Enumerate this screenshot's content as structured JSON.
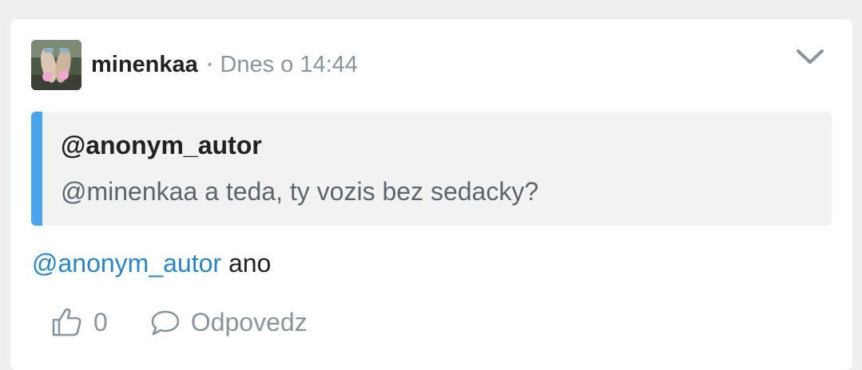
{
  "post": {
    "username": "minenkaa",
    "separator": "•",
    "timestamp": "Dnes o 14:44",
    "menu_icon": "chevron-down-icon",
    "quote": {
      "author": "@anonym_autor",
      "text": "@minenkaa a teda, ty vozis bez sedacky?"
    },
    "body": {
      "mention": "@anonym_autor",
      "text": " ano"
    },
    "actions": {
      "like_icon": "thumbs-up-icon",
      "like_count": "0",
      "reply_icon": "speech-bubble-icon",
      "reply_label": "Odpovedz"
    }
  },
  "colors": {
    "background": "#eeeff1",
    "card": "#ffffff",
    "quote_background": "#f2f2f3",
    "quote_accent": "#4ba4f0",
    "mention": "#2a85c7",
    "muted": "#8a949c"
  }
}
